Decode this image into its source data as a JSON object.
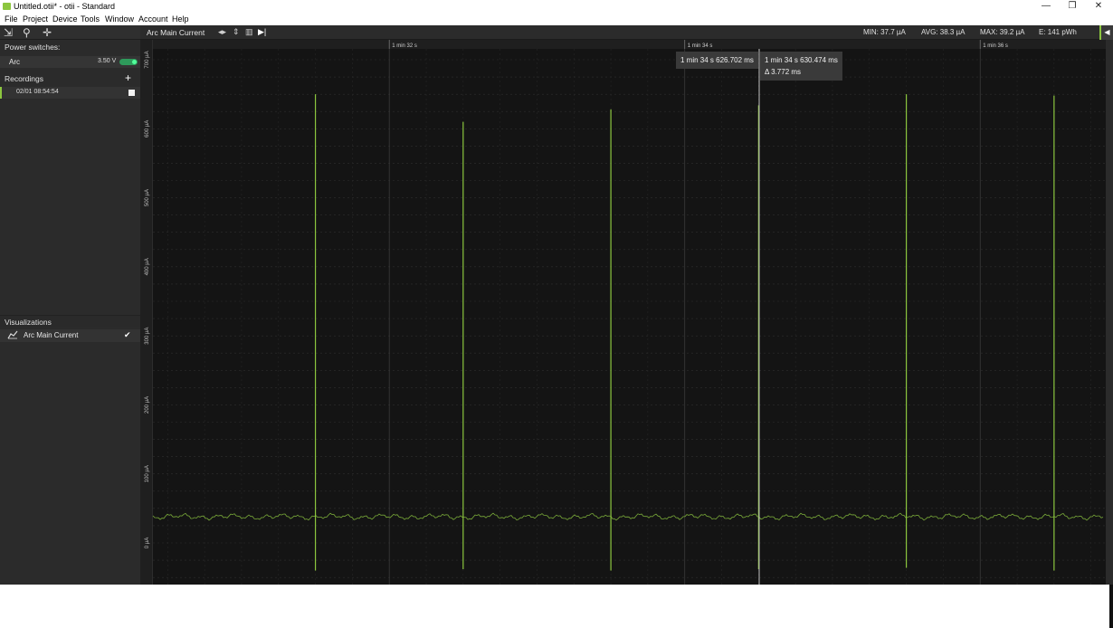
{
  "window": {
    "title": "Untitled.otii* - otii - Standard",
    "minimize": "—",
    "maximize": "❐",
    "close": "✕"
  },
  "menu": [
    "File",
    "Project",
    "Device",
    "Tools",
    "Window",
    "Account",
    "Help"
  ],
  "sidebar": {
    "tools": [
      "select-tool",
      "zoom-tool",
      "pan-tool"
    ],
    "power_switches_title": "Power switches:",
    "switch": {
      "label": "Arc",
      "voltage": "3.50 V",
      "on": true
    },
    "recordings_title": "Recordings",
    "add_symbol": "+",
    "recording": {
      "label": "02/01 08:54:54"
    },
    "visualizations_title": "Visualizations",
    "visualization": {
      "label": "Arc Main Current",
      "checked": true
    }
  },
  "graph_toolbar": {
    "title": "Arc Main Current",
    "stats": {
      "min": "MIN: 37.7 µA",
      "avg": "AVG: 38.3 µA",
      "max": "MAX: 39.2 µA",
      "energy": "E: 141 pWh"
    },
    "collapse_symbol": "◀"
  },
  "cursors": {
    "first": "1 min 34 s 626.702 ms",
    "second": "1 min 34 s 630.474 ms",
    "delta": "Δ 3.772 ms"
  },
  "colors": {
    "trace": "#8cc63f",
    "background": "#141414",
    "accent": "#8cc63f"
  },
  "chart_data": {
    "type": "line",
    "title": "Arc Main Current",
    "x_ticks": [
      "1 min 32 s",
      "1 min 34 s",
      "1 min 36 s"
    ],
    "y_ticks": [
      "0 µA",
      "100 µA",
      "200 µA",
      "300 µA",
      "400 µA",
      "500 µA",
      "600 µA",
      "700 µA"
    ],
    "ylim": [
      -60,
      740
    ],
    "baseline_current_uA": 38,
    "spikes": [
      {
        "time_s": 91.5,
        "peak_uA": 650,
        "min_uA": -40
      },
      {
        "time_s": 92.5,
        "peak_uA": 610,
        "min_uA": -38
      },
      {
        "time_s": 93.5,
        "peak_uA": 628,
        "min_uA": -40
      },
      {
        "time_s": 94.5,
        "peak_uA": 634,
        "min_uA": -38
      },
      {
        "time_s": 95.5,
        "peak_uA": 650,
        "min_uA": -36
      },
      {
        "time_s": 96.5,
        "peak_uA": 648,
        "min_uA": -40
      }
    ],
    "grid": true,
    "legend": "none"
  }
}
